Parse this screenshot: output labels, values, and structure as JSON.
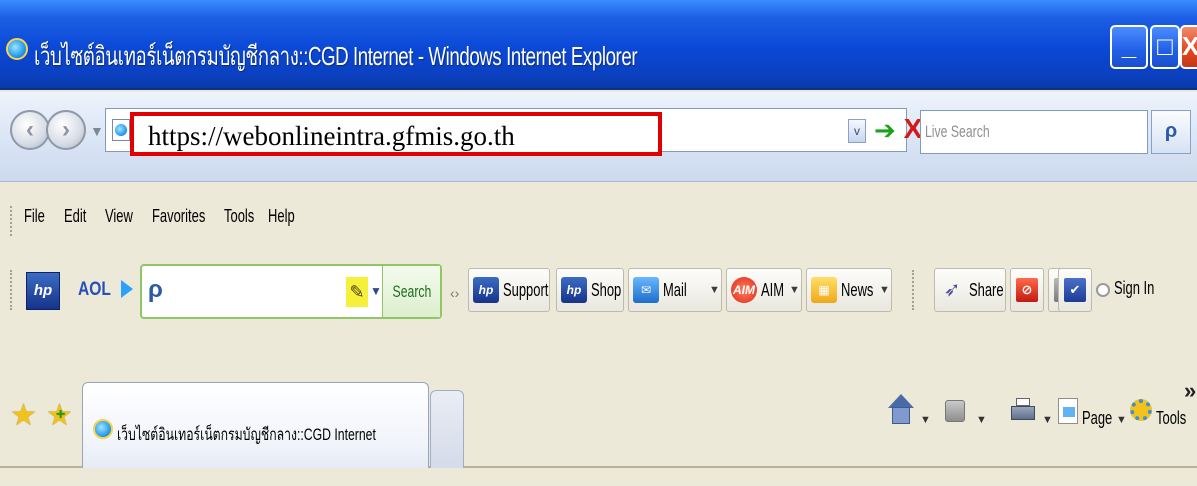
{
  "window": {
    "title": "เว็บไซต์อินเทอร์เน็ตกรมบัญชีกลาง::CGD Internet - Windows Internet Explorer",
    "min_label": "_",
    "max_label": "□",
    "close_label": "X"
  },
  "nav": {
    "back_glyph": "‹",
    "forward_glyph": "›",
    "dropdown_glyph": "▼",
    "address_url": "https://webonlineintra.gfmis.go.th",
    "go_glyph": "➔",
    "stop_glyph": "X",
    "address_dropdown_glyph": "v",
    "live_search_placeholder": "Live Search",
    "search_glyph": "ρ"
  },
  "menu": {
    "items": [
      "File",
      "Edit",
      "View",
      "Favorites",
      "Tools",
      "Help"
    ]
  },
  "aol_toolbar": {
    "hp_label": "hp",
    "aol_label": "AOL",
    "search_button": "Search",
    "buttons": [
      {
        "label": "Support",
        "icon": "hp-icon"
      },
      {
        "label": "Shop",
        "icon": "hp-icon"
      },
      {
        "label": "Mail",
        "icon": "mail-icon"
      },
      {
        "label": "AIM",
        "icon": "aim-icon"
      },
      {
        "label": "News",
        "icon": "news-icon"
      },
      {
        "label": "Share",
        "icon": "share-icon"
      }
    ],
    "sign_in": "Sign In"
  },
  "tabs": {
    "active_tab_title": "เว็บไซต์อินเทอร์เน็ตกรมบัญชีกลาง::CGD Internet"
  },
  "command_bar": {
    "page_label": "Page",
    "tools_label": "Tools",
    "more_glyph": "»"
  },
  "colors": {
    "title_bar": "#0a48d6",
    "address_highlight": "#e00000",
    "aol_search_border": "#8ec763"
  }
}
